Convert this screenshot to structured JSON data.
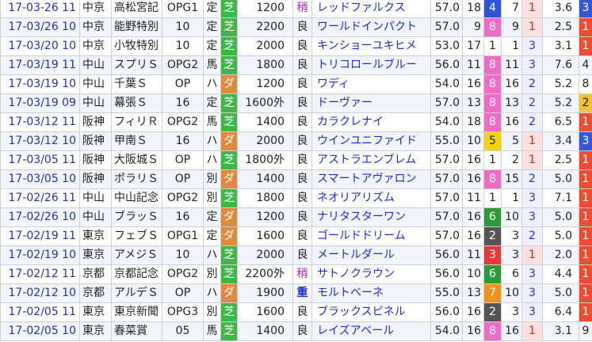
{
  "races": [
    {
      "date": "17-03-26 11",
      "place": "中京",
      "race": "高松宮記",
      "grade": "OPG1",
      "cond": "定",
      "surface": "芝",
      "distance": "1200",
      "going": "稍",
      "horse": "レッドファルクス",
      "weight": "57.0",
      "field": "18",
      "frame": "4",
      "number": "7",
      "pop": "1",
      "odds": "3.6",
      "rank": "3"
    },
    {
      "date": "17-03/26 10",
      "place": "中京",
      "race": "能野特別",
      "grade": "10",
      "cond": "定",
      "surface": "芝",
      "distance": "2200",
      "going": "良",
      "horse": "ワールドインパクト",
      "weight": "57.0",
      "field": "9",
      "frame": "8",
      "number": "9",
      "pop": "1",
      "odds": "2.5",
      "rank": "1"
    },
    {
      "date": "17-03/20 10",
      "place": "中京",
      "race": "小牧特別",
      "grade": "10",
      "cond": "定",
      "surface": "芝",
      "distance": "2000",
      "going": "良",
      "horse": "キンショーユキヒメ",
      "weight": "53.0",
      "field": "17",
      "frame": "1",
      "number": "1",
      "pop": "3",
      "odds": "3.1",
      "rank": "1"
    },
    {
      "date": "17-03/19 11",
      "place": "中山",
      "race": "スプリＳ",
      "grade": "OPG2",
      "cond": "馬",
      "surface": "芝",
      "distance": "1800",
      "going": "良",
      "horse": "トリコロールブルー",
      "weight": "56.0",
      "field": "11",
      "frame": "8",
      "number": "11",
      "pop": "3",
      "odds": "7.6",
      "rank": "4"
    },
    {
      "date": "17-03/19 10",
      "place": "中山",
      "race": "千葉Ｓ",
      "grade": "OP",
      "cond": "ハ",
      "surface": "ダ",
      "distance": "1200",
      "going": "良",
      "horse": "ワディ",
      "weight": "54.0",
      "field": "16",
      "frame": "8",
      "number": "16",
      "pop": "2",
      "odds": "5.2",
      "rank": "8"
    },
    {
      "date": "17-03/19 09",
      "place": "中山",
      "race": "幕張Ｓ",
      "grade": "16",
      "cond": "定",
      "surface": "芝",
      "distance": "1600外",
      "going": "良",
      "horse": "ドーヴァー",
      "weight": "57.0",
      "field": "13",
      "frame": "8",
      "number": "13",
      "pop": "2",
      "odds": "5.2",
      "rank": "2"
    },
    {
      "date": "17-03/12 11",
      "place": "阪神",
      "race": "フィリＲ",
      "grade": "OPG2",
      "cond": "馬",
      "surface": "芝",
      "distance": "1400",
      "going": "良",
      "horse": "カラクレナイ",
      "weight": "54.0",
      "field": "18",
      "frame": "8",
      "number": "16",
      "pop": "2",
      "odds": "6.5",
      "rank": "1"
    },
    {
      "date": "17-03/12 10",
      "place": "阪神",
      "race": "甲南Ｓ",
      "grade": "16",
      "cond": "ハ",
      "surface": "ダ",
      "distance": "2000",
      "going": "良",
      "horse": "ウインユニファイド",
      "weight": "55.0",
      "field": "10",
      "frame": "5",
      "number": "5",
      "pop": "1",
      "odds": "3.4",
      "rank": "3"
    },
    {
      "date": "17-03/05 11",
      "place": "阪神",
      "race": "大阪城Ｓ",
      "grade": "OP",
      "cond": "ハ",
      "surface": "芝",
      "distance": "1800外",
      "going": "良",
      "horse": "アストラエンブレム",
      "weight": "57.0",
      "field": "16",
      "frame": "1",
      "number": "2",
      "pop": "1",
      "odds": "2.5",
      "rank": "1"
    },
    {
      "date": "17-03/05 10",
      "place": "阪神",
      "race": "ポラリＳ",
      "grade": "OP",
      "cond": "別",
      "surface": "ダ",
      "distance": "1400",
      "going": "良",
      "horse": "スマートアヴァロン",
      "weight": "57.0",
      "field": "16",
      "frame": "8",
      "number": "15",
      "pop": "2",
      "odds": "5.0",
      "rank": "1"
    },
    {
      "date": "17-02/26 11",
      "place": "中山",
      "race": "中山記念",
      "grade": "OPG2",
      "cond": "別",
      "surface": "芝",
      "distance": "1800",
      "going": "良",
      "horse": "ネオリアリズム",
      "weight": "57.0",
      "field": "11",
      "frame": "1",
      "number": "1",
      "pop": "3",
      "odds": "7.1",
      "rank": "1"
    },
    {
      "date": "17-02/26 10",
      "place": "中山",
      "race": "ブラッＳ",
      "grade": "16",
      "cond": "定",
      "surface": "ダ",
      "distance": "1200",
      "going": "良",
      "horse": "ナリタスターワン",
      "weight": "57.0",
      "field": "16",
      "frame": "6",
      "number": "10",
      "pop": "3",
      "odds": "5.0",
      "rank": "1"
    },
    {
      "date": "17-02/19 11",
      "place": "東京",
      "race": "フェブＳ",
      "grade": "OPG1",
      "cond": "定",
      "surface": "ダ",
      "distance": "1600",
      "going": "良",
      "horse": "ゴールドドリーム",
      "weight": "57.0",
      "field": "16",
      "frame": "2",
      "number": "3",
      "pop": "2",
      "odds": "5.0",
      "rank": "1"
    },
    {
      "date": "17-02/19 10",
      "place": "東京",
      "race": "アメジＳ",
      "grade": "10",
      "cond": "ハ",
      "surface": "芝",
      "distance": "2000",
      "going": "良",
      "horse": "メートルダール",
      "weight": "56.0",
      "field": "11",
      "frame": "3",
      "number": "3",
      "pop": "1",
      "odds": "2.0",
      "rank": "1"
    },
    {
      "date": "17-02/12 11",
      "place": "京都",
      "race": "京都記念",
      "grade": "OPG2",
      "cond": "別",
      "surface": "芝",
      "distance": "2200外",
      "going": "稍",
      "horse": "サトノクラウン",
      "weight": "56.0",
      "field": "10",
      "frame": "6",
      "number": "6",
      "pop": "3",
      "odds": "4.4",
      "rank": "1"
    },
    {
      "date": "17-02/12 10",
      "place": "京都",
      "race": "アルデＳ",
      "grade": "OP",
      "cond": "ハ",
      "surface": "ダ",
      "distance": "1900",
      "going": "重",
      "horse": "モルトベーネ",
      "weight": "55.0",
      "field": "13",
      "frame": "7",
      "number": "10",
      "pop": "3",
      "odds": "5.0",
      "rank": "1"
    },
    {
      "date": "17-02/05 11",
      "place": "東京",
      "race": "東京新聞",
      "grade": "OPG3",
      "cond": "別",
      "surface": "芝",
      "distance": "1600",
      "going": "良",
      "horse": "ブラックスピネル",
      "weight": "56.0",
      "field": "16",
      "frame": "2",
      "number": "3",
      "pop": "3",
      "odds": "6.4",
      "rank": "1"
    },
    {
      "date": "17-02/05 10",
      "place": "東京",
      "race": "春菜賞",
      "grade": "05",
      "cond": "馬",
      "surface": "芝",
      "distance": "1400",
      "going": "良",
      "horse": "レイズアベール",
      "weight": "54.0",
      "field": "16",
      "frame": "8",
      "number": "16",
      "pop": "1",
      "odds": "3.1",
      "rank": "9"
    }
  ]
}
